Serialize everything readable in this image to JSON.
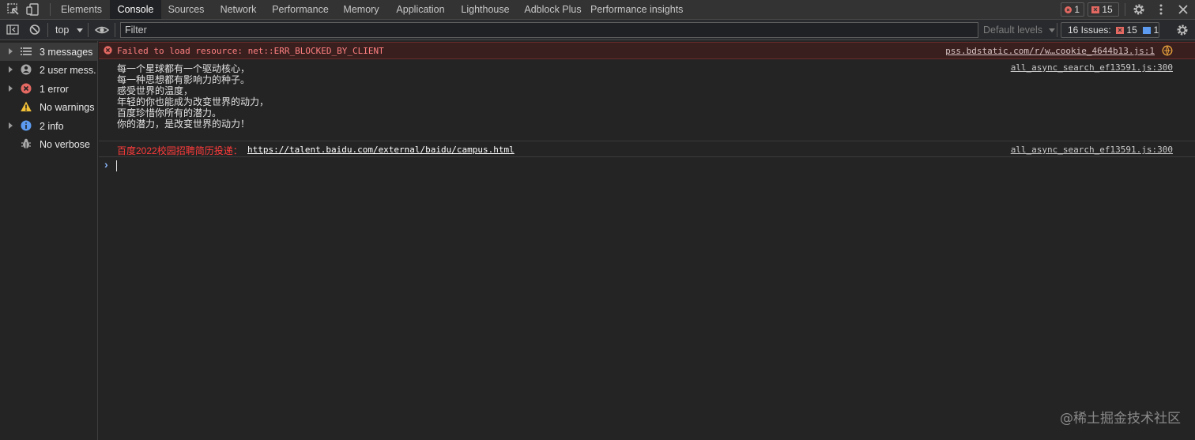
{
  "tabs": [
    {
      "label": "Elements"
    },
    {
      "label": "Console"
    },
    {
      "label": "Sources"
    },
    {
      "label": "Network"
    },
    {
      "label": "Performance"
    },
    {
      "label": "Memory"
    },
    {
      "label": "Application"
    },
    {
      "label": "Lighthouse"
    },
    {
      "label": "Adblock Plus"
    },
    {
      "label": "Performance insights"
    }
  ],
  "active_tab": "Console",
  "header_badges": {
    "errors": "1",
    "issues": "15"
  },
  "toolbar": {
    "context": "top",
    "filter_placeholder": "Filter",
    "levels": "Default levels",
    "issues_label": "16 Issues:",
    "issues_errors": "15",
    "issues_info": "1"
  },
  "sidebar": {
    "items": [
      {
        "label": "3 messages",
        "icon": "list-icon"
      },
      {
        "label": "2 user mess...",
        "icon": "user-icon"
      },
      {
        "label": "1 error",
        "icon": "error-icon"
      },
      {
        "label": "No warnings",
        "icon": "warning-icon"
      },
      {
        "label": "2 info",
        "icon": "info-icon"
      },
      {
        "label": "No verbose",
        "icon": "bug-icon"
      }
    ]
  },
  "console": {
    "error": {
      "text": "Failed to load resource: net::ERR_BLOCKED_BY_CLIENT",
      "source": "pss.bdstatic.com/r/w…cookie_4644b13.js:1"
    },
    "log1": {
      "lines": [
        "每一个星球都有一个驱动核心，",
        "每一种思想都有影响力的种子。",
        "感受世界的温度，",
        "年轻的你也能成为改变世界的动力，",
        "百度珍惜你所有的潜力。",
        "你的潜力，是改变世界的动力！"
      ],
      "source": "all_async_search_ef13591.js:300"
    },
    "log2": {
      "prefix": "百度2022校园招聘简历投递：",
      "link": "https://talent.baidu.com/external/baidu/campus.html",
      "source": "all_async_search_ef13591.js:300"
    },
    "prompt": "›"
  },
  "colors": {
    "error_text": "#ff8080",
    "accent": "#8ab4f8",
    "error_bg": "#3a1f1f"
  },
  "watermark": "@稀土掘金技术社区"
}
